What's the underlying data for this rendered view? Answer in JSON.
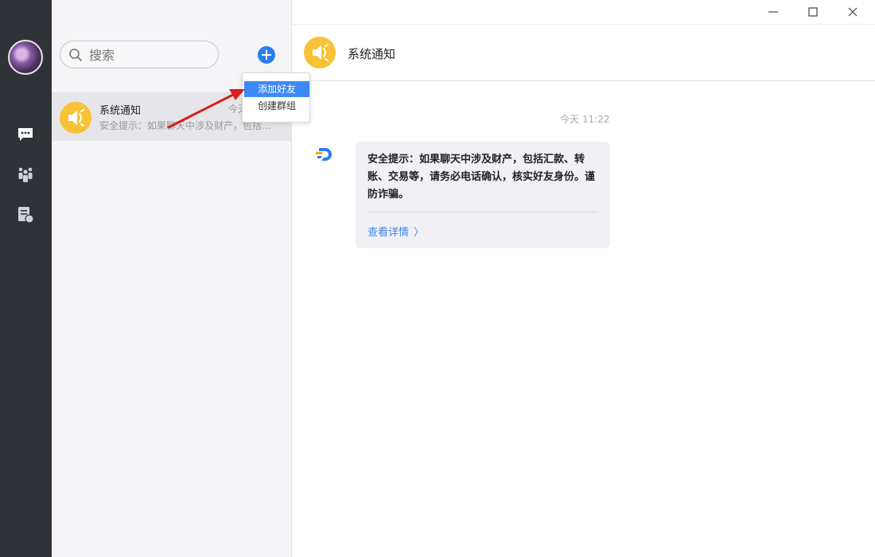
{
  "search": {
    "placeholder": "搜索"
  },
  "add_menu": {
    "items": [
      {
        "label": "添加好友",
        "active": true
      },
      {
        "label": "创建群组",
        "active": false
      }
    ]
  },
  "conversations": [
    {
      "name": "系统通知",
      "time": "今天",
      "preview": "安全提示：如果聊天中涉及财产，包括...",
      "avatar_icon": "speaker-icon"
    }
  ],
  "chat": {
    "title": "系统通知",
    "message_time": "今天 11:22",
    "message_text": "安全提示：如果聊天中涉及财产，包括汇款、转账、交易等，请务必电话确认，核实好友身份。谨防诈骗。",
    "link_label": "查看详情",
    "link_chevron": "〉"
  },
  "colors": {
    "nav_bg": "#2f3237",
    "accent": "#2b7cf0",
    "menu_highlight": "#3d8af7",
    "notification_avatar": "#f7c236",
    "link": "#3a86e8"
  },
  "icons": {
    "nav": [
      "chat-icon",
      "contacts-icon",
      "notes-icon"
    ],
    "window": [
      "minimize-icon",
      "maximize-icon",
      "close-icon"
    ]
  }
}
